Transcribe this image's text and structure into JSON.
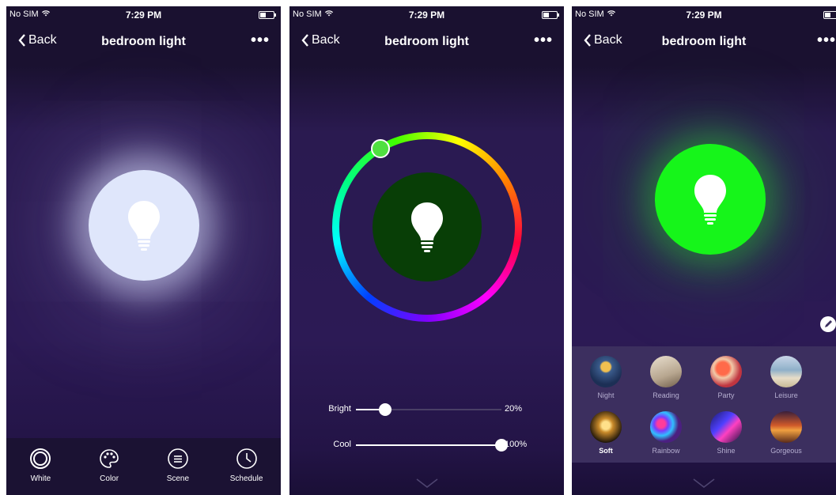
{
  "status": {
    "carrier": "No SIM",
    "time": "7:29 PM"
  },
  "nav": {
    "back_label": "Back",
    "title": "bedroom light",
    "more": "•••"
  },
  "panel1": {
    "bulb_color": "#dfe6fb",
    "tabs": [
      {
        "label": "White",
        "icon": "white-circle-icon"
      },
      {
        "label": "Color",
        "icon": "palette-icon"
      },
      {
        "label": "Scene",
        "icon": "scene-list-icon"
      },
      {
        "label": "Schedule",
        "icon": "clock-icon"
      }
    ]
  },
  "panel2": {
    "bulb_color": "#083e06",
    "picker_color": "#50e040",
    "sliders": [
      {
        "label": "Bright",
        "value_text": "20%",
        "fraction": 0.2
      },
      {
        "label": "Cool",
        "value_text": "100%",
        "fraction": 1.0
      }
    ]
  },
  "panel3": {
    "bulb_color": "#16f51a",
    "scenes": [
      {
        "label": "Night",
        "active": false
      },
      {
        "label": "Reading",
        "active": false
      },
      {
        "label": "Party",
        "active": false
      },
      {
        "label": "Leisure",
        "active": false
      },
      {
        "label": "Soft",
        "active": true
      },
      {
        "label": "Rainbow",
        "active": false
      },
      {
        "label": "Shine",
        "active": false
      },
      {
        "label": "Gorgeous",
        "active": false
      }
    ]
  }
}
